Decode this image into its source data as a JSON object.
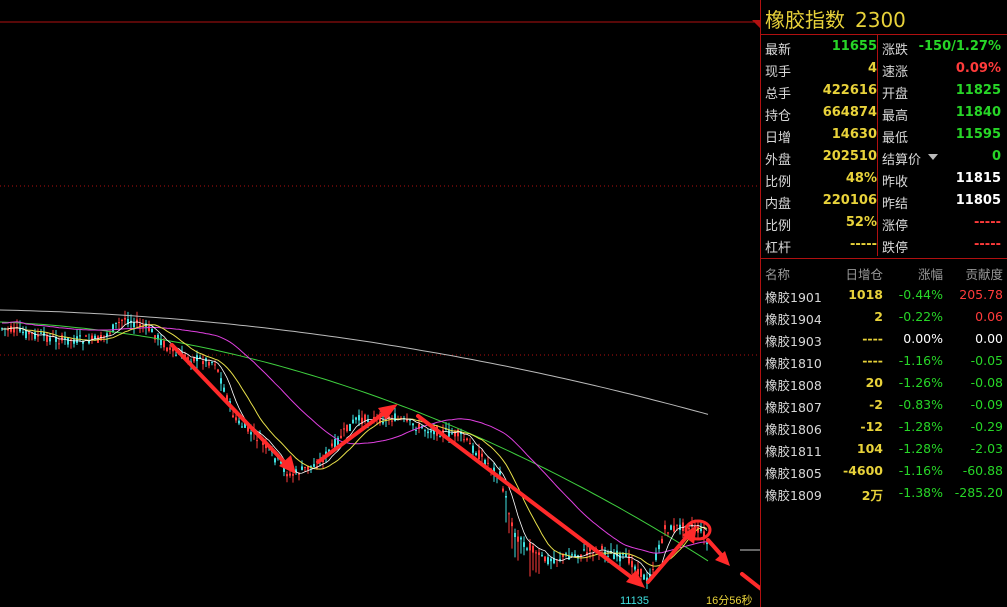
{
  "header": {
    "name": "橡胶指数",
    "code": "2300"
  },
  "quote_rows": [
    {
      "l_label": "最新",
      "l_value": "11655",
      "l_color": "#27d627",
      "r_label": "涨跌",
      "r_value": "-150/1.27%",
      "r_color": "#27d627"
    },
    {
      "l_label": "现手",
      "l_value": "4",
      "l_color": "#e8d23a",
      "r_label": "速涨",
      "r_value": "0.09%",
      "r_color": "#ff3b3b"
    },
    {
      "l_label": "总手",
      "l_value": "422616",
      "l_color": "#e8d23a",
      "r_label": "开盘",
      "r_value": "11825",
      "r_color": "#27d627"
    },
    {
      "l_label": "持仓",
      "l_value": "664874",
      "l_color": "#e8d23a",
      "r_label": "最高",
      "r_value": "11840",
      "r_color": "#27d627"
    },
    {
      "l_label": "日增",
      "l_value": "14630",
      "l_color": "#e8d23a",
      "r_label": "最低",
      "r_value": "11595",
      "r_color": "#27d627"
    },
    {
      "l_label": "外盘",
      "l_value": "202510",
      "l_color": "#e8d23a",
      "r_label": "结算价",
      "r_value": "0",
      "r_color": "#27d627"
    },
    {
      "l_label": "比例",
      "l_value": "48%",
      "l_color": "#e8d23a",
      "r_label": "昨收",
      "r_value": "11815",
      "r_color": "#ffffff"
    },
    {
      "l_label": "内盘",
      "l_value": "220106",
      "l_color": "#e8d23a",
      "r_label": "昨结",
      "r_value": "11805",
      "r_color": "#ffffff"
    },
    {
      "l_label": "比例",
      "l_value": "52%",
      "l_color": "#e8d23a",
      "r_label": "涨停",
      "r_value": "-----",
      "r_color": "#ff3b3b"
    },
    {
      "l_label": "杠杆",
      "l_value": "-----",
      "l_color": "#e8d23a",
      "r_label": "跌停",
      "r_value": "-----",
      "r_color": "#ff3b3b"
    }
  ],
  "contrib_header": {
    "name": "名称",
    "inc": "日增仓",
    "chg": "涨幅",
    "con": "贡献度"
  },
  "contrib_rows": [
    {
      "name": "橡胶1901",
      "inc": "1018",
      "chg": "-0.44%",
      "con": "205.78",
      "chg_color": "#27d627",
      "con_color": "#ff3b3b"
    },
    {
      "name": "橡胶1904",
      "inc": "2",
      "chg": "-0.22%",
      "con": "0.06",
      "chg_color": "#27d627",
      "con_color": "#ff3b3b"
    },
    {
      "name": "橡胶1903",
      "inc": "----",
      "chg": "0.00%",
      "con": "0.00",
      "chg_color": "#ffffff",
      "con_color": "#ffffff"
    },
    {
      "name": "橡胶1810",
      "inc": "----",
      "chg": "-1.16%",
      "con": "-0.05",
      "chg_color": "#27d627",
      "con_color": "#27d627"
    },
    {
      "name": "橡胶1808",
      "inc": "20",
      "chg": "-1.26%",
      "con": "-0.08",
      "chg_color": "#27d627",
      "con_color": "#27d627"
    },
    {
      "name": "橡胶1807",
      "inc": "-2",
      "chg": "-0.83%",
      "con": "-0.09",
      "chg_color": "#27d627",
      "con_color": "#27d627"
    },
    {
      "name": "橡胶1806",
      "inc": "-12",
      "chg": "-1.28%",
      "con": "-0.29",
      "chg_color": "#27d627",
      "con_color": "#27d627"
    },
    {
      "name": "橡胶1811",
      "inc": "104",
      "chg": "-1.28%",
      "con": "-2.03",
      "chg_color": "#27d627",
      "con_color": "#27d627"
    },
    {
      "name": "橡胶1805",
      "inc": "-4600",
      "chg": "-1.16%",
      "con": "-60.88",
      "chg_color": "#27d627",
      "con_color": "#27d627"
    },
    {
      "name": "橡胶1809",
      "inc": "2万",
      "chg": "-1.38%",
      "con": "-285.20",
      "chg_color": "#27d627",
      "con_color": "#27d627"
    }
  ],
  "chart": {
    "low_label": "11135",
    "time_label": "16分56秒",
    "colors": {
      "grid": "#b01010",
      "up": "#ff3b3b",
      "down": "#3fe0e0",
      "ma_yellow": "#e8e04a",
      "ma_magenta": "#e040e0",
      "ma_green": "#3fcf3f",
      "ma_gray": "#bbbbbb",
      "arrow": "#ff2a2a"
    }
  }
}
